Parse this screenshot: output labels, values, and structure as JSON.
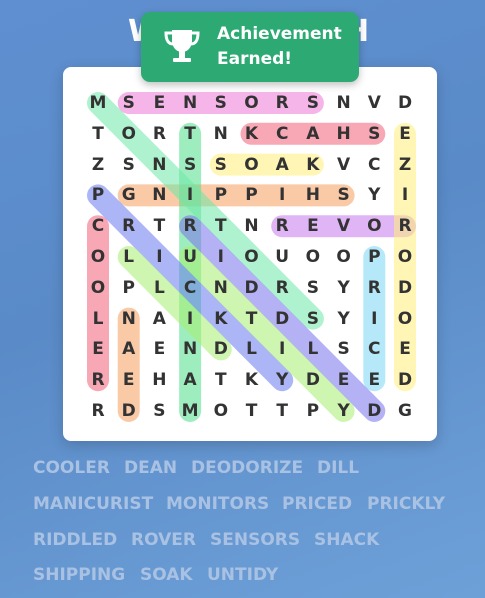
{
  "header": {
    "title_visible_left": "W",
    "title_visible_right": "H"
  },
  "toast": {
    "icon": "trophy-icon",
    "line1": "Achievement",
    "line2": "Earned!"
  },
  "grid": {
    "rows": [
      [
        "M",
        "S",
        "E",
        "N",
        "S",
        "O",
        "R",
        "S",
        "N",
        "V",
        "D"
      ],
      [
        "T",
        "O",
        "R",
        "T",
        "N",
        "K",
        "C",
        "A",
        "H",
        "S",
        "E"
      ],
      [
        "Z",
        "S",
        "N",
        "S",
        "S",
        "O",
        "A",
        "K",
        "V",
        "C",
        "Z"
      ],
      [
        "P",
        "G",
        "N",
        "I",
        "P",
        "P",
        "I",
        "H",
        "S",
        "Y",
        "I"
      ],
      [
        "C",
        "R",
        "T",
        "R",
        "T",
        "N",
        "R",
        "E",
        "V",
        "O",
        "R"
      ],
      [
        "O",
        "L",
        "I",
        "U",
        "I",
        "O",
        "U",
        "O",
        "O",
        "P",
        "O"
      ],
      [
        "O",
        "P",
        "L",
        "C",
        "N",
        "D",
        "R",
        "S",
        "Y",
        "R",
        "D"
      ],
      [
        "L",
        "N",
        "A",
        "I",
        "K",
        "T",
        "D",
        "S",
        "Y",
        "I",
        "O"
      ],
      [
        "E",
        "A",
        "E",
        "N",
        "D",
        "L",
        "I",
        "L",
        "S",
        "C",
        "E"
      ],
      [
        "R",
        "E",
        "H",
        "A",
        "T",
        "K",
        "Y",
        "D",
        "E",
        "E",
        "D"
      ],
      [
        "R",
        "D",
        "S",
        "M",
        "O",
        "T",
        "T",
        "P",
        "Y",
        "D",
        "G"
      ]
    ]
  },
  "found": [
    {
      "word": "SENSORS",
      "from": [
        0,
        1
      ],
      "to": [
        0,
        7
      ],
      "color": "#f07ad8"
    },
    {
      "word": "SHACK",
      "from": [
        1,
        9
      ],
      "to": [
        1,
        5
      ],
      "color": "#f4607a"
    },
    {
      "word": "SOAK",
      "from": [
        2,
        4
      ],
      "to": [
        2,
        7
      ],
      "color": "#fff07a"
    },
    {
      "word": "SHIPPING",
      "from": [
        3,
        8
      ],
      "to": [
        3,
        1
      ],
      "color": "#f7a060"
    },
    {
      "word": "ROVER",
      "from": [
        4,
        10
      ],
      "to": [
        4,
        6
      ],
      "color": "#c77af0"
    },
    {
      "word": "COOLER",
      "from": [
        4,
        0
      ],
      "to": [
        9,
        0
      ],
      "color": "#f4607a"
    },
    {
      "word": "DEAN",
      "from": [
        10,
        1
      ],
      "to": [
        7,
        1
      ],
      "color": "#f7a060"
    },
    {
      "word": "MANICURIST",
      "from": [
        10,
        3
      ],
      "to": [
        1,
        3
      ],
      "color": "#50e08a"
    },
    {
      "word": "DEODORIZE",
      "from": [
        9,
        10
      ],
      "to": [
        1,
        10
      ],
      "color": "#fff07a"
    },
    {
      "word": "PRICED",
      "from": [
        5,
        9
      ],
      "to": [
        9,
        9
      ],
      "color": "#7ad8f5"
    },
    {
      "word": "MONITORS",
      "from": [
        0,
        0
      ],
      "to": [
        7,
        7
      ],
      "color": "#6ee8a8"
    },
    {
      "word": "PRICKLY",
      "from": [
        3,
        0
      ],
      "to": [
        9,
        6
      ],
      "color": "#6a7cf0"
    },
    {
      "word": "RIDDLED",
      "from": [
        4,
        3
      ],
      "to": [
        10,
        9
      ],
      "color": "#7a72ee"
    },
    {
      "word": "DILL",
      "from": [
        5,
        1
      ],
      "to": [
        8,
        4
      ],
      "color": "#a8f070"
    },
    {
      "word": "UNTIDY",
      "from": [
        5,
        3
      ],
      "to": [
        10,
        8
      ],
      "color": "#a8f070"
    }
  ],
  "word_list": [
    "COOLER",
    "DEAN",
    "DEODORIZE",
    "DILL",
    "MANICURIST",
    "MONITORS",
    "PRICED",
    "PRICKLY",
    "RIDDLED",
    "ROVER",
    "SENSORS",
    "SHACK",
    "SHIPPING",
    "SOAK",
    "UNTIDY"
  ]
}
